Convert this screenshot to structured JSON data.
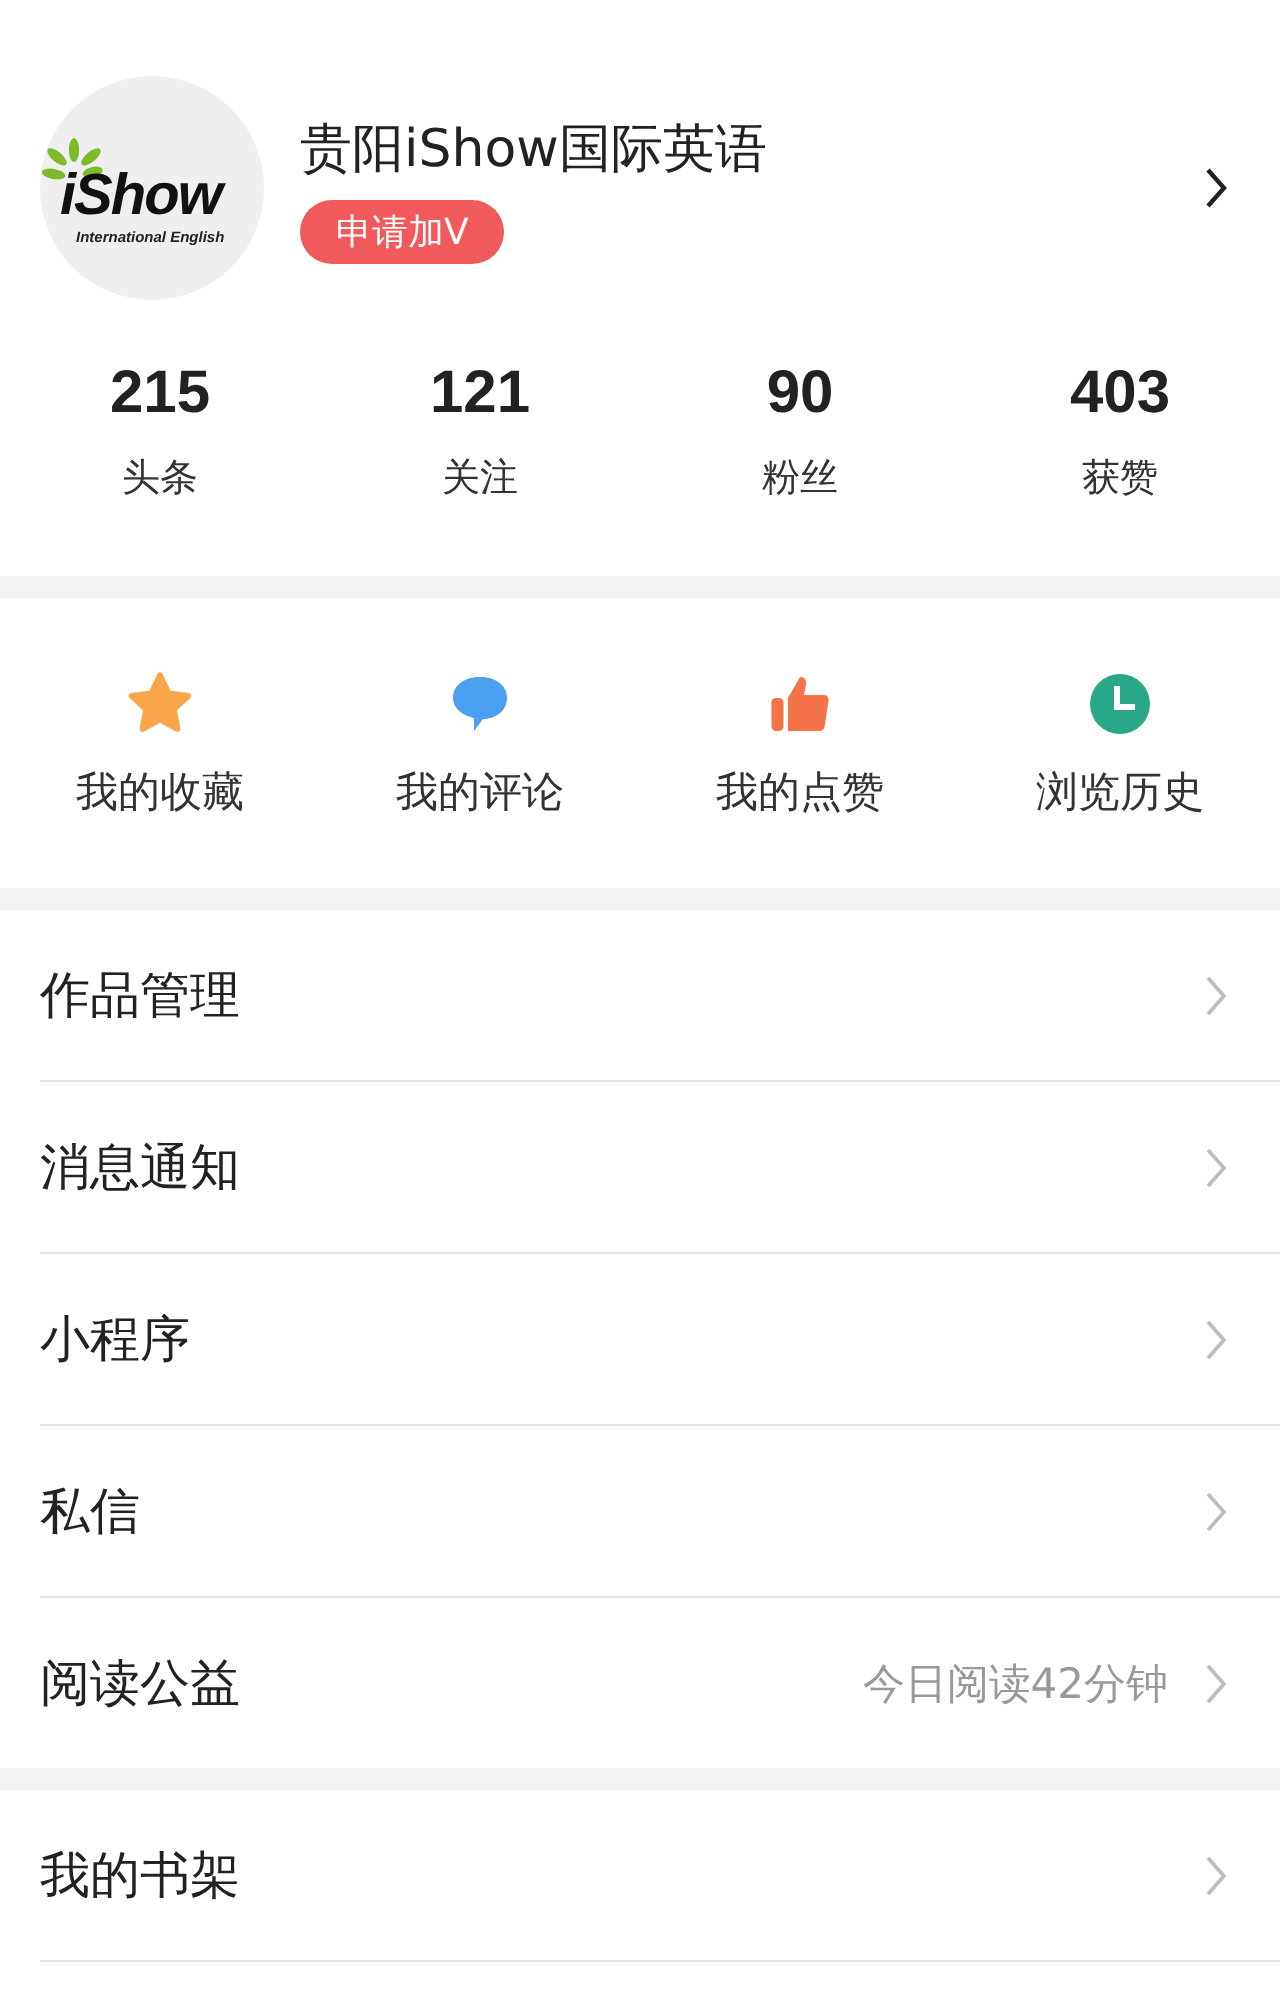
{
  "profile": {
    "logo_text": "iShow",
    "logo_subtext": "International English",
    "name": "贵阳iShow国际英语",
    "verify_button": "申请加V"
  },
  "stats": [
    {
      "value": "215",
      "label": "头条"
    },
    {
      "value": "121",
      "label": "关注"
    },
    {
      "value": "90",
      "label": "粉丝"
    },
    {
      "value": "403",
      "label": "获赞"
    }
  ],
  "shortcuts": [
    {
      "kind": "star",
      "label": "我的收藏",
      "color": "#f9a64a"
    },
    {
      "kind": "comment",
      "label": "我的评论",
      "color": "#4a9ff0"
    },
    {
      "kind": "like",
      "label": "我的点赞",
      "color": "#f47349"
    },
    {
      "kind": "history",
      "label": "浏览历史",
      "color": "#2aa786"
    }
  ],
  "menu_groups": [
    [
      {
        "label": "作品管理"
      },
      {
        "label": "消息通知"
      },
      {
        "label": "小程序"
      },
      {
        "label": "私信"
      },
      {
        "label": "阅读公益",
        "value": "今日阅读42分钟"
      }
    ],
    [
      {
        "label": "我的书架"
      }
    ]
  ]
}
